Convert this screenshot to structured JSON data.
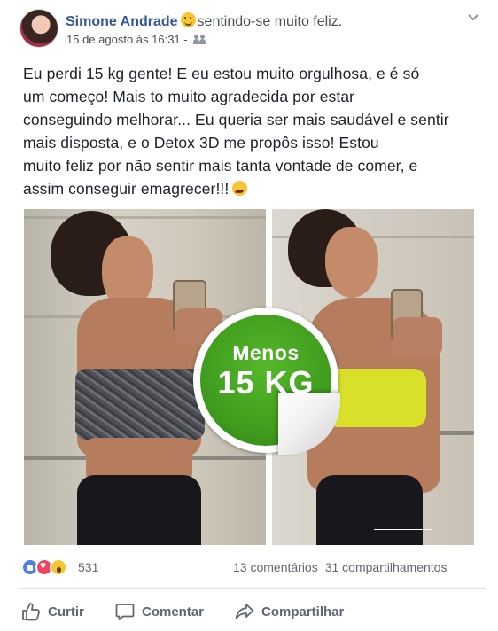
{
  "header": {
    "author": "Simone Andrade",
    "feeling": "sentindo-se muito feliz.",
    "timestamp": "15 de agosto às 16:31 -",
    "privacy_icon": "friends-icon",
    "menu_icon": "chevron-down-icon"
  },
  "post": {
    "lines": [
      "Eu perdi 15 kg gente! E eu estou muito orgulhosa, e é só",
      "um começo! Mais to muito agradecida por estar",
      "conseguindo melhorar... Eu queria ser mais saudável e sentir",
      "mais disposta, e o Detox 3D me propôs isso! Estou",
      "muito feliz por não sentir mais tanta vontade de comer, e",
      "assim conseguir emagrecer!!!"
    ],
    "emoji": "heart-eyes-emoji"
  },
  "photo": {
    "badge_top": "Menos",
    "badge_main": "15 KG"
  },
  "stats": {
    "reaction_icons": [
      "like-reaction-icon",
      "love-reaction-icon",
      "wow-reaction-icon"
    ],
    "reaction_count": "531",
    "comments": "13 comentários",
    "shares": "31 compartilhamentos"
  },
  "actions": {
    "like": "Curtir",
    "comment": "Comentar",
    "share": "Compartilhar"
  },
  "colors": {
    "author_link": "#365899",
    "badge_green": "#3f9b1d",
    "action_gray": "#616770"
  }
}
